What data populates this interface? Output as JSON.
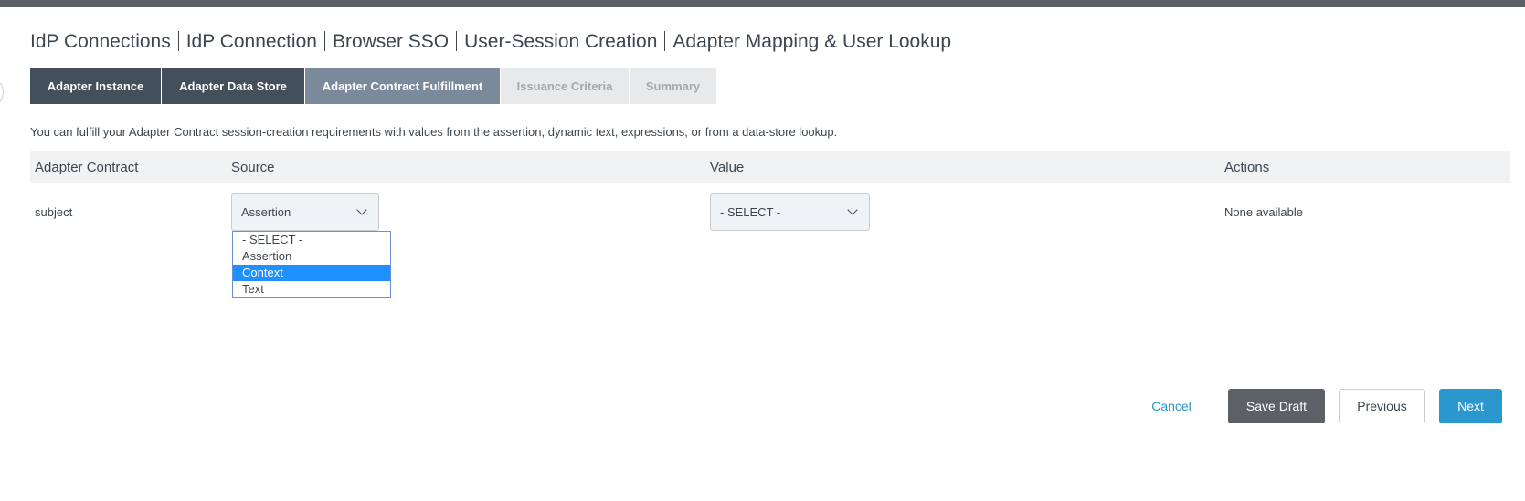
{
  "breadcrumb": [
    "IdP Connections",
    "IdP Connection",
    "Browser SSO",
    "User-Session Creation",
    "Adapter Mapping & User Lookup"
  ],
  "tabs": [
    {
      "label": "Adapter Instance",
      "state": "done"
    },
    {
      "label": "Adapter Data Store",
      "state": "done"
    },
    {
      "label": "Adapter Contract Fulfillment",
      "state": "active"
    },
    {
      "label": "Issuance Criteria",
      "state": "disabled"
    },
    {
      "label": "Summary",
      "state": "disabled"
    }
  ],
  "description": "You can fulfill your Adapter Contract session-creation requirements with values from the assertion, dynamic text, expressions, or from a data-store lookup.",
  "table": {
    "headers": [
      "Adapter Contract",
      "Source",
      "Value",
      "Actions"
    ],
    "rows": [
      {
        "contract": "subject",
        "source": "Assertion",
        "value": "- SELECT -",
        "actions": "None available"
      }
    ]
  },
  "source_dropdown": {
    "options": [
      "- SELECT -",
      "Assertion",
      "Context",
      "Text"
    ],
    "highlighted": "Context"
  },
  "footer": {
    "cancel": "Cancel",
    "save_draft": "Save Draft",
    "previous": "Previous",
    "next": "Next"
  },
  "colors": {
    "accent": "#2b97cf",
    "tab_done": "#434f5a",
    "tab_active": "#7b8a9b",
    "highlight": "#1e90ff"
  }
}
